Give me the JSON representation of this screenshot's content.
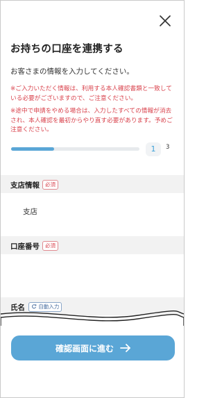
{
  "header": {
    "close_icon": "close-icon",
    "title": "お持ちの口座を連携する",
    "lead": "お客さまの情報を入力してください。"
  },
  "notices": [
    "※ご入力いただく情報は、利用する本人確認書類と一致している必要がございますので、ご注意ください。",
    "※途中で申請をやめる場合は、入力したすべての情報が消去され、本人確認を最初からやり直す必要があります。予めご注意ください。"
  ],
  "progress": {
    "current_step": "1",
    "total_steps": "3",
    "fraction": 0.333
  },
  "sections": {
    "branch": {
      "label": "支店情報",
      "badge": "必須",
      "value": "支店"
    },
    "account_number": {
      "label": "口座番号",
      "badge": "必須",
      "value": ""
    },
    "name": {
      "label": "氏名",
      "badge": "自動入力",
      "badge_icon": "sync-icon"
    }
  },
  "footer": {
    "cta_label": "確認画面に進む",
    "cta_icon": "arrow-right-icon"
  },
  "colors": {
    "accent": "#5aa6d6",
    "warning": "#d9434d",
    "band": "#f2f2f2"
  }
}
